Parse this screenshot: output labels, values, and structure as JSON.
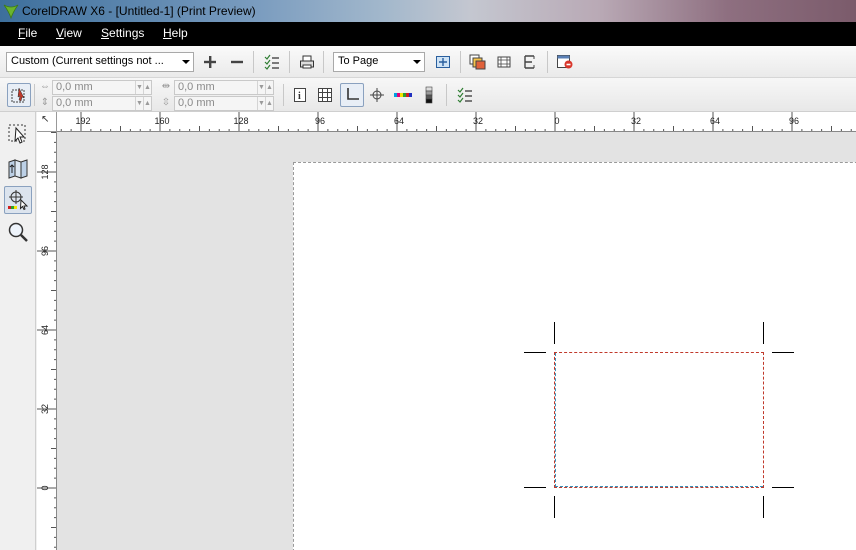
{
  "window": {
    "title": "CorelDRAW X6 - [Untitled-1] (Print Preview)"
  },
  "menu": [
    {
      "label": "File",
      "mnemonic": "F",
      "rest": "ile"
    },
    {
      "label": "View",
      "mnemonic": "V",
      "rest": "iew"
    },
    {
      "label": "Settings",
      "mnemonic": "S",
      "rest": "ettings"
    },
    {
      "label": "Help",
      "mnemonic": "H",
      "rest": "elp"
    }
  ],
  "toolbar": {
    "style_combo": "Custom (Current settings not ...",
    "zoom_combo": "To Page",
    "icons": [
      "add-style-icon",
      "remove-style-icon",
      "print-options-icon",
      "print-icon",
      "full-screen-icon",
      "enable-color-separations-icon",
      "invert-icon",
      "mirror-icon",
      "close-print-preview-icon"
    ]
  },
  "property_bar": {
    "x_field": "0,0 mm",
    "y_field": "0,0 mm",
    "w_field": "0,0 mm",
    "h_field": "0,0 mm",
    "icons": [
      "pick-tool-icon",
      "info-icon",
      "grid-icon",
      "crop-marks-icon",
      "registration-mark-icon",
      "color-bar-icon",
      "density-scale-icon",
      "print-options-icon"
    ]
  },
  "toolbox": {
    "tools": [
      "pick-tool",
      "imposition-layout-tool",
      "marks-placement-tool",
      "zoom-tool"
    ],
    "active": "marks-placement-tool"
  },
  "rulers": {
    "horizontal_labels": [
      "192",
      "160",
      "128",
      "96",
      "64",
      "32",
      "0",
      "32",
      "64",
      "96"
    ],
    "vertical_labels": [
      "128",
      "96",
      "64",
      "32",
      "0"
    ],
    "unit_corner": "↖"
  }
}
